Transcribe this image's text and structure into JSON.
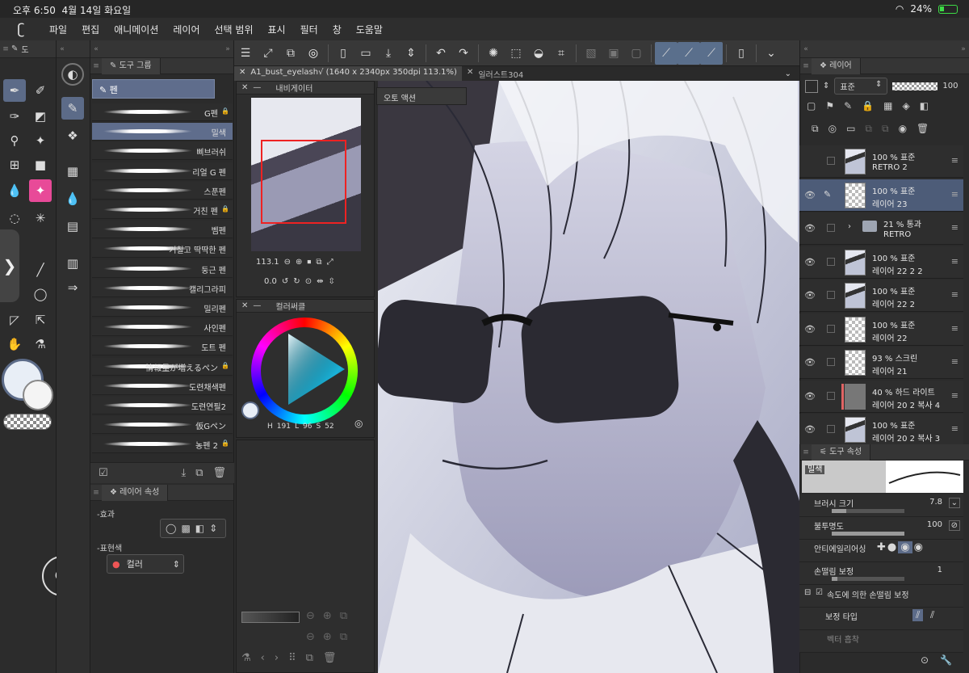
{
  "status": {
    "time": "오후 6:50",
    "date": "4월 14일 화요일",
    "battery": "24%",
    "wifi_icon": "wifi-icon"
  },
  "menu": [
    "파일",
    "편집",
    "애니메이션",
    "레이어",
    "선택 범위",
    "표시",
    "필터",
    "창",
    "도움말"
  ],
  "tabs": {
    "doc1": "A1_bust_eyelash√ (1640 x 2340px 350dpi 113.1%)",
    "doc2": "일러스트304",
    "autoaction": "오토 액션"
  },
  "tool_panel": {
    "tab_label": "도",
    "color_mode_label": "컬러"
  },
  "tool_group": {
    "header": "도구 그룹",
    "subtool_title": "펜"
  },
  "brushes": [
    {
      "name": "G펜",
      "locked": true
    },
    {
      "name": "밀색",
      "locked": false
    },
    {
      "name": "삐브러쉬",
      "locked": false
    },
    {
      "name": "리얼 G 펜",
      "locked": false
    },
    {
      "name": "스푼펜",
      "locked": false
    },
    {
      "name": "거친 펜",
      "locked": true
    },
    {
      "name": "벰펜",
      "locked": false
    },
    {
      "name": "거칠고 딱딱한 펜",
      "locked": false
    },
    {
      "name": "둥근 펜",
      "locked": false
    },
    {
      "name": "캘리그라피",
      "locked": false
    },
    {
      "name": "밀리펜",
      "locked": false
    },
    {
      "name": "사인펜",
      "locked": false
    },
    {
      "name": "도트 펜",
      "locked": false
    },
    {
      "name": "情報量が増えるペン",
      "locked": true
    },
    {
      "name": "도련채색펜",
      "locked": false
    },
    {
      "name": "도련연필2",
      "locked": false
    },
    {
      "name": "仮Gペン",
      "locked": false
    },
    {
      "name": "농펜 2",
      "locked": true
    }
  ],
  "layer_props": {
    "header": "레이어 속성",
    "effect": "효과",
    "expression_color": "표현색",
    "color_value": "컬러"
  },
  "navigator": {
    "title": "내비게이터",
    "zoom": "113.1",
    "rotation": "0.0"
  },
  "color_circle": {
    "title": "컬러써클",
    "h_label": "H",
    "h": "191",
    "l_label": "L",
    "l": "96",
    "s_label": "S",
    "s": "52"
  },
  "layers_panel": {
    "header": "레이어",
    "blend": "표준",
    "opacity": "100"
  },
  "layers": [
    {
      "percent": "100 %",
      "mode": "표준",
      "name": "RETRO 2",
      "thumb": "pic",
      "eye": false,
      "selected": false
    },
    {
      "percent": "100 %",
      "mode": "표준",
      "name": "레이어 23",
      "thumb": "check",
      "eye": true,
      "selected": true
    },
    {
      "percent": "21 %",
      "mode": "통과",
      "name": "RETRO",
      "thumb": "folder",
      "eye": true,
      "selected": false
    },
    {
      "percent": "100 %",
      "mode": "표준",
      "name": "레이어 22 2 2",
      "thumb": "pic",
      "eye": true,
      "selected": false
    },
    {
      "percent": "100 %",
      "mode": "표준",
      "name": "레이어 22 2",
      "thumb": "pic",
      "eye": true,
      "selected": false
    },
    {
      "percent": "100 %",
      "mode": "표준",
      "name": "레이어 22",
      "thumb": "check",
      "eye": true,
      "selected": false
    },
    {
      "percent": "93 %",
      "mode": "스크린",
      "name": "레이어 21",
      "thumb": "check",
      "eye": true,
      "selected": false
    },
    {
      "percent": "40 %",
      "mode": "하드 라이트",
      "name": "레이어 20 2 복사 4",
      "thumb": "grey",
      "eye": true,
      "selected": false
    },
    {
      "percent": "100 %",
      "mode": "표준",
      "name": "레이어 20 2 복사 3",
      "thumb": "pic",
      "eye": true,
      "selected": false
    }
  ],
  "tool_props": {
    "header": "도구 속성",
    "brush_name": "밀색",
    "size_label": "브러시 크기",
    "size": "7.8",
    "opacity_label": "불투명도",
    "opacity": "100",
    "aa_label": "안티에일리어싱",
    "stab_label": "손떨림 보정",
    "stab": "1",
    "speed_stab_label": "속도에 의한 손떨림 보정",
    "correct_type_label": "보정 타입",
    "vector_label": "벡터 흡착"
  },
  "colors": {
    "accent": "#5c6b88",
    "panel": "#2e2e2e",
    "main_color": "#e8eef6",
    "pink_tool": "#e84a98"
  }
}
